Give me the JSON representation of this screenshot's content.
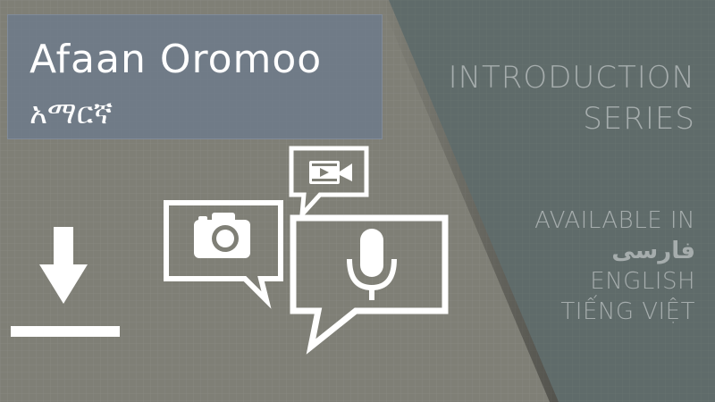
{
  "colors": {
    "left_background": "#7f7f76",
    "right_background": "#5f6b6a",
    "title_box": "#6c7a8c",
    "icon_white": "#ffffff",
    "right_text": "#a6adad"
  },
  "title": {
    "main": "Afaan Oromoo",
    "sub": "አማርኛ"
  },
  "series": {
    "line1": "INTRODUCTION",
    "line2": "SERIES"
  },
  "availability": {
    "heading": "AVAILABLE IN",
    "languages": [
      "فارسی",
      "ENGLISH",
      "TIẾNG VIỆT"
    ]
  },
  "icons": {
    "download": "download-arrow-icon",
    "camera": "camera-icon",
    "video": "video-camera-icon",
    "microphone": "microphone-icon"
  }
}
